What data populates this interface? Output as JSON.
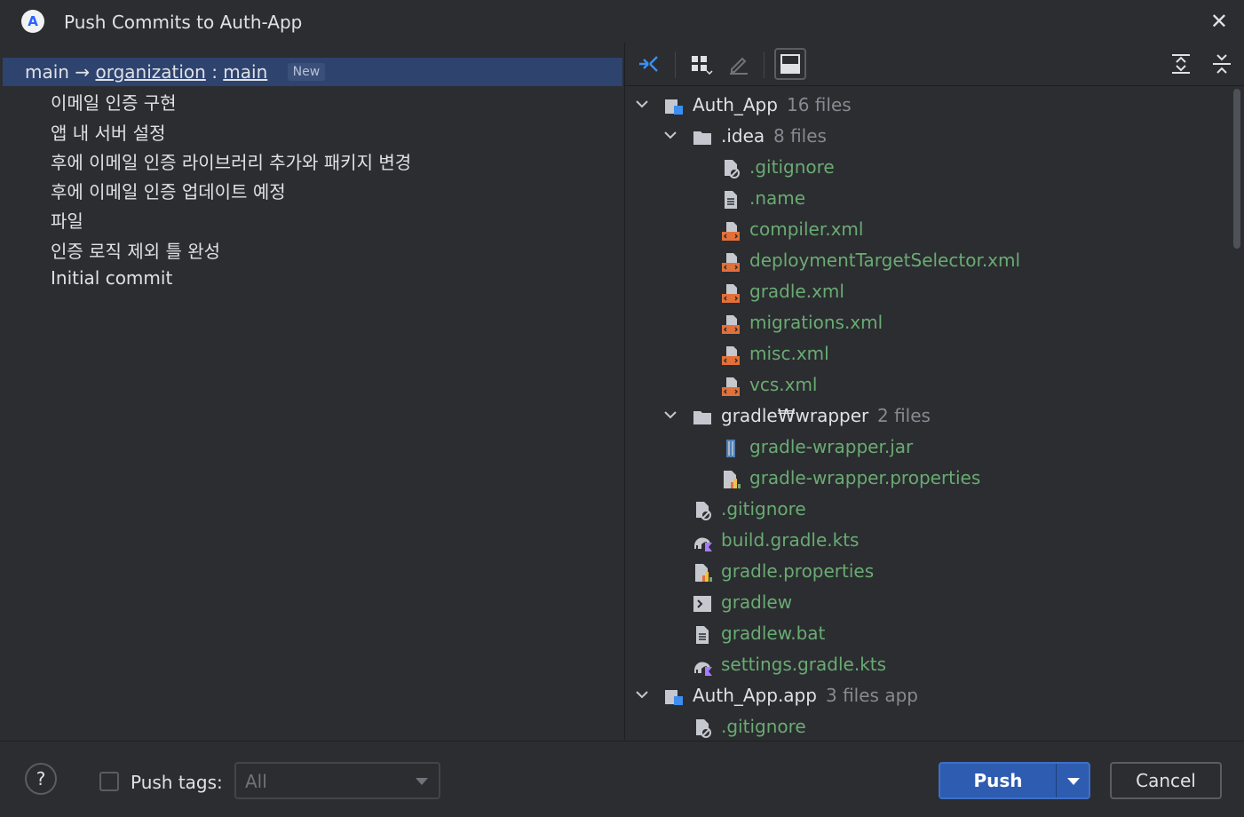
{
  "window": {
    "title": "Push Commits to Auth-App",
    "app_icon": "android-studio-icon",
    "close_icon": "close-icon"
  },
  "branch": {
    "local": "main",
    "arrow": "→",
    "remote": "organization",
    "separator": ":",
    "remote_branch": "main",
    "badge": "New"
  },
  "commits": [
    "이메일 인증 구현",
    "앱 내 서버 설정",
    "후에 이메일 인증 라이브러리 추가와 패키지 변경",
    "후에 이메일 인증 업데이트 예정",
    "파일",
    "인증 로직 제외 틀 완성",
    "Initial commit"
  ],
  "toolbar": {
    "icons": [
      "pin-icon",
      "group-by-icon",
      "edit-icon",
      "preview-icon",
      "expand-all-icon",
      "collapse-all-icon"
    ]
  },
  "tree": [
    {
      "level": 0,
      "chevron": "expanded",
      "icon": "module-icon",
      "name": "Auth_App",
      "meta": "16 files",
      "kind": "folder"
    },
    {
      "level": 1,
      "chevron": "expanded",
      "icon": "folder-icon",
      "name": ".idea",
      "meta": "8 files",
      "kind": "folder"
    },
    {
      "level": 2,
      "icon": "ignore-file-icon",
      "name": ".gitignore",
      "kind": "file"
    },
    {
      "level": 2,
      "icon": "text-file-icon",
      "name": ".name",
      "kind": "file"
    },
    {
      "level": 2,
      "icon": "xml-file-icon",
      "name": "compiler.xml",
      "kind": "file"
    },
    {
      "level": 2,
      "icon": "xml-file-icon",
      "name": "deploymentTargetSelector.xml",
      "kind": "file"
    },
    {
      "level": 2,
      "icon": "xml-file-icon",
      "name": "gradle.xml",
      "kind": "file"
    },
    {
      "level": 2,
      "icon": "xml-file-icon",
      "name": "migrations.xml",
      "kind": "file"
    },
    {
      "level": 2,
      "icon": "xml-file-icon",
      "name": "misc.xml",
      "kind": "file"
    },
    {
      "level": 2,
      "icon": "xml-file-icon",
      "name": "vcs.xml",
      "kind": "file"
    },
    {
      "level": 1,
      "chevron": "expanded",
      "icon": "folder-icon",
      "name": "gradle₩wrapper",
      "meta": "2 files",
      "kind": "folder"
    },
    {
      "level": 2,
      "icon": "jar-file-icon",
      "name": "gradle-wrapper.jar",
      "kind": "file"
    },
    {
      "level": 2,
      "icon": "properties-file-icon",
      "name": "gradle-wrapper.properties",
      "kind": "file"
    },
    {
      "level": 1,
      "icon": "ignore-file-icon",
      "name": ".gitignore",
      "kind": "file"
    },
    {
      "level": 1,
      "icon": "gradle-kts-icon",
      "name": "build.gradle.kts",
      "kind": "file"
    },
    {
      "level": 1,
      "icon": "properties-file-icon",
      "name": "gradle.properties",
      "kind": "file"
    },
    {
      "level": 1,
      "icon": "shell-script-icon",
      "name": "gradlew",
      "kind": "file"
    },
    {
      "level": 1,
      "icon": "text-file-icon",
      "name": "gradlew.bat",
      "kind": "file"
    },
    {
      "level": 1,
      "icon": "gradle-kts-icon",
      "name": "settings.gradle.kts",
      "kind": "file"
    },
    {
      "level": 0,
      "chevron": "expanded",
      "icon": "module-icon",
      "name": "Auth_App.app",
      "meta": "3 files  app",
      "kind": "folder"
    },
    {
      "level": 1,
      "icon": "ignore-file-icon",
      "name": ".gitignore",
      "kind": "file"
    }
  ],
  "bottom": {
    "help_label": "?",
    "push_tags_label": "Push tags:",
    "push_tags_checked": false,
    "tags_select_value": "All",
    "push_label": "Push",
    "cancel_label": "Cancel"
  },
  "colors": {
    "background": "#2b2d30",
    "selection": "#2e436e",
    "file_added": "#6aab73",
    "primary_button": "#2e5cb0"
  }
}
